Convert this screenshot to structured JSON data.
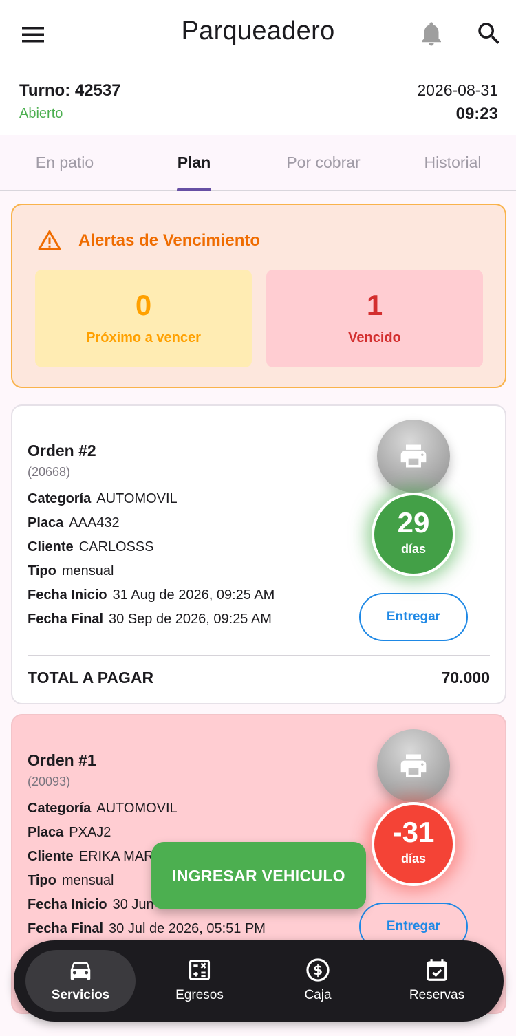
{
  "app_bar": {
    "title": "Parqueadero",
    "icons": [
      "menu-icon",
      "bell-icon",
      "search-icon"
    ]
  },
  "shift": {
    "turno_label": "Turno: 42537",
    "status": "Abierto",
    "date": "2026-08-31",
    "time": "09:23"
  },
  "tabs": [
    {
      "label": "En patio",
      "active": false
    },
    {
      "label": "Plan",
      "active": true
    },
    {
      "label": "Por cobrar",
      "active": false
    },
    {
      "label": "Historial",
      "active": false
    }
  ],
  "alerts": {
    "title": "Alertas de Vencimiento",
    "upcoming": {
      "count": "0",
      "label": "Próximo a vencer"
    },
    "expired": {
      "count": "1",
      "label": "Vencido"
    }
  },
  "orders": [
    {
      "title": "Orden #2",
      "id": "(20668)",
      "categoria": "AUTOMOVIL",
      "placa": "AAA432",
      "cliente": "CARLOSSS",
      "tipo": "mensual",
      "fecha_inicio": "31 Aug de 2026, 09:25 AM",
      "fecha_final": "30 Sep de 2026, 09:25 AM",
      "days": "29",
      "days_label": "días",
      "deliver_label": "Entregar",
      "total_label": "TOTAL A PAGAR",
      "total_value": "70.000"
    },
    {
      "title": "Orden #1",
      "id": "(20093)",
      "categoria": "AUTOMOVIL",
      "placa": "PXAJ2",
      "cliente": "ERIKA MAR",
      "tipo": "mensual",
      "fecha_inicio": "30 Jun",
      "fecha_final": "30 Jul de 2026, 05:51 PM",
      "days": "-31",
      "days_label": "días",
      "deliver_label": "Entregar"
    }
  ],
  "field_labels": {
    "categoria": "Categoría",
    "placa": "Placa",
    "cliente": "Cliente",
    "tipo": "Tipo",
    "fecha_inicio": "Fecha Inicio",
    "fecha_final": "Fecha Final"
  },
  "fab": {
    "label": "INGRESAR VEHICULO"
  },
  "bottom_nav": [
    {
      "label": "Servicios",
      "icon": "car-icon",
      "active": true
    },
    {
      "label": "Egresos",
      "icon": "calculator-icon",
      "active": false
    },
    {
      "label": "Caja",
      "icon": "dollar-icon",
      "active": false
    },
    {
      "label": "Reservas",
      "icon": "calendar-check-icon",
      "active": false
    }
  ],
  "colors": {
    "green": "#4caf50",
    "red": "#f44336",
    "orange": "#ef6c00",
    "blue": "#1e88e5",
    "tab_indicator": "#6750a4"
  }
}
